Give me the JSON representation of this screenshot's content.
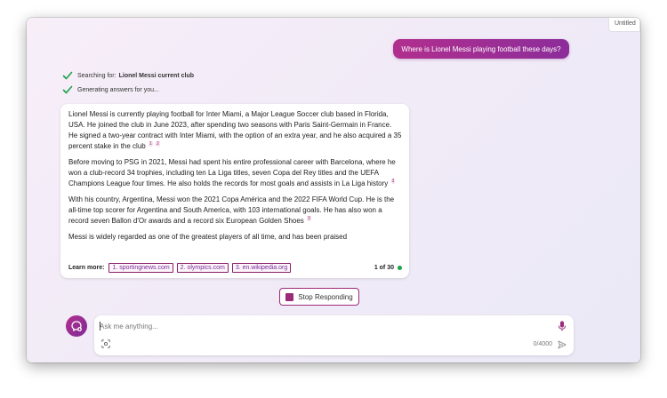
{
  "side_tab": {
    "label": "Untitled"
  },
  "user_message": "Where is Lionel Messi playing football these days?",
  "status": {
    "searching_prefix": "Searching for:",
    "searching_query": "Lionel Messi current club",
    "generating": "Generating answers for you..."
  },
  "answer": {
    "paragraphs": [
      {
        "text": "Lionel Messi is currently playing football for Inter Miami, a Major League Soccer club based in Florida, USA. He joined the club in June 2023, after spending two seasons with Paris Saint-Germain in France. He signed a two-year contract with Inter Miami, with the option of an extra year, and he also acquired a 35 percent stake in the club",
        "cites": [
          "1",
          "2"
        ]
      },
      {
        "text": "Before moving to PSG in 2021, Messi had spent his entire professional career with Barcelona, where he won a club-record 34 trophies, including ten La Liga titles, seven Copa del Rey titles and the UEFA Champions League four times. He also holds the records for most goals and assists in La Liga history",
        "cites": [
          "3"
        ]
      },
      {
        "text": "With his country, Argentina, Messi won the 2021 Copa América and the 2022 FIFA World Cup. He is the all-time top scorer for Argentina and South America, with 103 international goals. He has also won a record seven Ballon d'Or awards and a record six European Golden Shoes",
        "cites": [
          "3"
        ]
      },
      {
        "text": "Messi is widely regarded as one of the greatest players of all time, and has been praised",
        "cites": []
      }
    ],
    "learn_more_label": "Learn more:",
    "links": [
      "1. sportingnews.com",
      "2. olympics.com",
      "3. en.wikipedia.org"
    ],
    "pager": "1 of 30",
    "pager_color": "#1aa34a"
  },
  "stop_button": {
    "label": "Stop Responding"
  },
  "composer": {
    "placeholder": "Ask me anything...",
    "char_count": "0/4000"
  },
  "colors": {
    "accent": "#9b2a7a",
    "bubble_start": "#b12f8e",
    "bubble_end": "#8c2d9a",
    "check": "#1aa34a"
  },
  "icons": {
    "status_check": "check-icon",
    "avatar": "new-topic-icon",
    "mic": "mic-icon",
    "image": "image-search-icon",
    "send": "send-icon",
    "stop": "stop-icon"
  }
}
